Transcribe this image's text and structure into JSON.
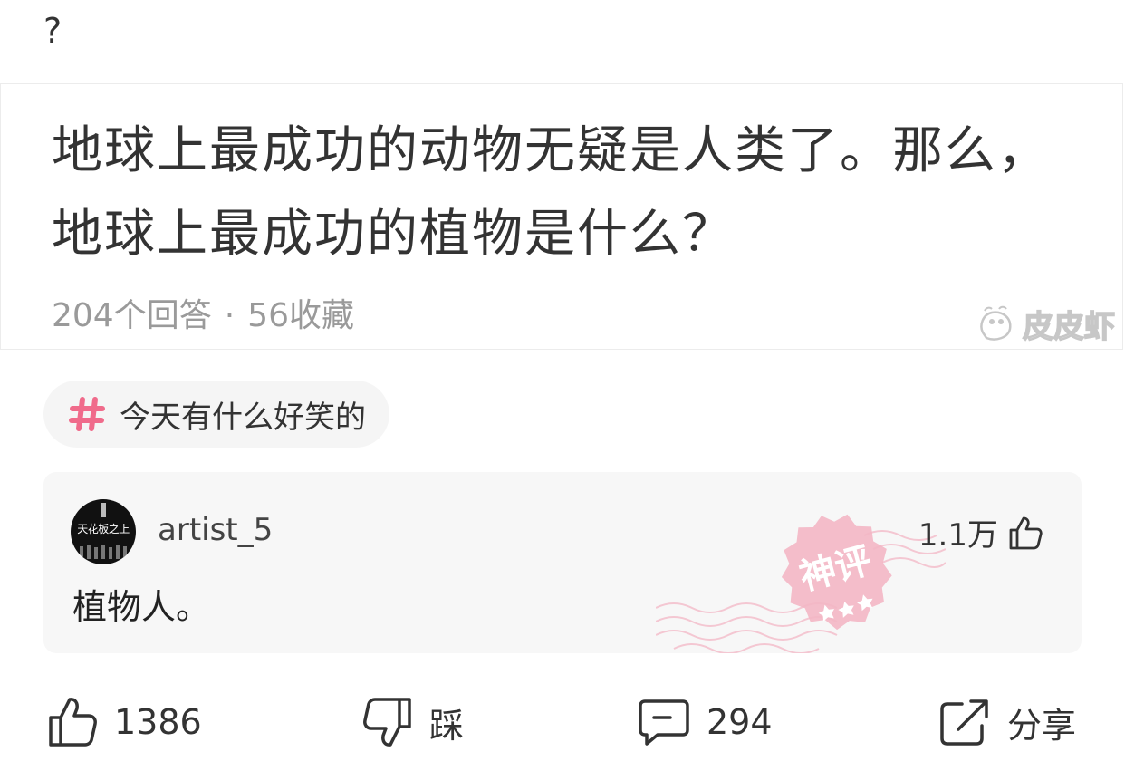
{
  "top_mark": "?",
  "question": {
    "title": "地球上最成功的动物无疑是人类了。那么，地球上最成功的植物是什么？",
    "answers_label": "204个回答",
    "separator": "·",
    "favorites_label": "56收藏",
    "watermark": "皮皮虾"
  },
  "topic": {
    "icon": "hashtag-icon",
    "label": "今天有什么好笑的",
    "icon_color": "#f06b8b"
  },
  "comment": {
    "avatar_text": "天花板之上",
    "username": "artist_5",
    "likes": "1.1万",
    "text": "植物人。",
    "stamp_text": "神评",
    "stamp_color": "#f0a3b4"
  },
  "actions": {
    "like_count": "1386",
    "dislike_label": "踩",
    "comment_count": "294",
    "share_label": "分享"
  }
}
